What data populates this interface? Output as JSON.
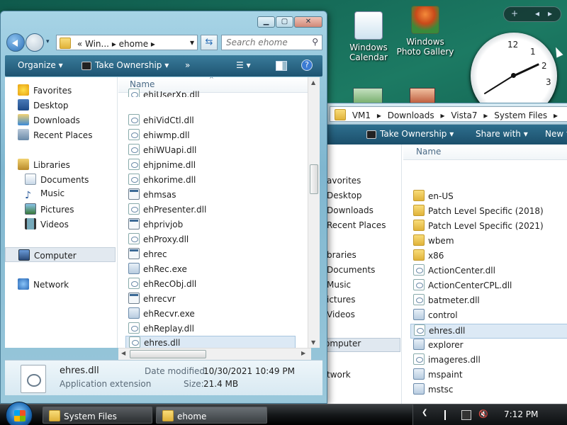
{
  "desktop": {
    "icons": [
      {
        "label_line1": "Windows",
        "label_line2": "Calendar"
      },
      {
        "label_line1": "Windows",
        "label_line2": "Photo Gallery"
      }
    ],
    "gadget_bar": {
      "add": "+",
      "prev": "◂",
      "next": "▸"
    },
    "clock": {
      "numbers": [
        "12",
        "1",
        "2",
        "3"
      ]
    }
  },
  "back_window": {
    "breadcrumbs": [
      "VM1",
      "▸",
      "Downloads",
      "▸",
      "Vista7",
      "▸",
      "System Files",
      "▸"
    ],
    "toolbar": {
      "take_ownership": "Take Ownership",
      "share_with": "Share with",
      "new_folder": "New f"
    },
    "nav_items": [
      "avorites",
      "Desktop",
      "Downloads",
      "Recent Places",
      "braries",
      "Documents",
      "Music",
      "ictures",
      "Videos",
      "omputer",
      "twork"
    ],
    "column_header": "Name",
    "files": [
      {
        "name": "en-US",
        "icon": "folder-icon"
      },
      {
        "name": "Patch Level Specific (2018)",
        "icon": "folder-icon"
      },
      {
        "name": "Patch Level Specific (2021)",
        "icon": "folder-icon"
      },
      {
        "name": "wbem",
        "icon": "folder-icon"
      },
      {
        "name": "x86",
        "icon": "folder-icon"
      },
      {
        "name": "ActionCenter.dll",
        "icon": "dll-icon"
      },
      {
        "name": "ActionCenterCPL.dll",
        "icon": "dll-icon"
      },
      {
        "name": "batmeter.dll",
        "icon": "dll-icon"
      },
      {
        "name": "control",
        "icon": "exe-icon"
      },
      {
        "name": "ehres.dll",
        "icon": "dll-icon"
      },
      {
        "name": "explorer",
        "icon": "exe-icon"
      },
      {
        "name": "imageres.dll",
        "icon": "dll-icon"
      },
      {
        "name": "mspaint",
        "icon": "exe-icon"
      },
      {
        "name": "mstsc",
        "icon": "exe-icon"
      }
    ],
    "selected_file": "ehres.dll"
  },
  "front_window": {
    "address": {
      "prefix": "«",
      "part1": "Win...",
      "sep": "▸",
      "part2": "ehome",
      "sep2": "▸"
    },
    "search_placeholder": "Search ehome",
    "toolbar": {
      "organize": "Organize",
      "take_ownership": "Take Ownership",
      "more": "»"
    },
    "nav_items": [
      {
        "label": "Favorites",
        "icon": "star-icon"
      },
      {
        "label": "Desktop",
        "icon": "desktop-icon"
      },
      {
        "label": "Downloads",
        "icon": "downloads-icon"
      },
      {
        "label": "Recent Places",
        "icon": "recent-places-icon"
      },
      {
        "label": "Libraries",
        "icon": "libraries-icon"
      },
      {
        "label": "Documents",
        "icon": "documents-icon"
      },
      {
        "label": "Music",
        "icon": "music-icon"
      },
      {
        "label": "Pictures",
        "icon": "pictures-icon"
      },
      {
        "label": "Videos",
        "icon": "videos-icon"
      },
      {
        "label": "Computer",
        "icon": "computer-icon"
      },
      {
        "label": "Network",
        "icon": "network-icon"
      }
    ],
    "column_header": "Name",
    "files": [
      {
        "name": "ehiUserXp.dll",
        "icon": "dll-icon"
      },
      {
        "name": "ehiVidCtl.dll",
        "icon": "dll-icon"
      },
      {
        "name": "ehiwmp.dll",
        "icon": "dll-icon"
      },
      {
        "name": "ehiWUapi.dll",
        "icon": "dll-icon"
      },
      {
        "name": "ehjpnime.dll",
        "icon": "dll-icon"
      },
      {
        "name": "ehkorime.dll",
        "icon": "dll-icon"
      },
      {
        "name": "ehmsas",
        "icon": "app-icon"
      },
      {
        "name": "ehPresenter.dll",
        "icon": "dll-icon"
      },
      {
        "name": "ehprivjob",
        "icon": "app-icon"
      },
      {
        "name": "ehProxy.dll",
        "icon": "dll-icon"
      },
      {
        "name": "ehrec",
        "icon": "app-icon"
      },
      {
        "name": "ehRec.exe",
        "icon": "exe-icon"
      },
      {
        "name": "ehRecObj.dll",
        "icon": "dll-icon"
      },
      {
        "name": "ehrecvr",
        "icon": "app-icon"
      },
      {
        "name": "ehRecvr.exe",
        "icon": "exe-icon"
      },
      {
        "name": "ehReplay.dll",
        "icon": "dll-icon"
      },
      {
        "name": "ehres.dll",
        "icon": "dll-icon"
      }
    ],
    "selected_file": "ehres.dll",
    "details": {
      "name": "ehres.dll",
      "type": "Application extension",
      "modified_label": "Date modified:",
      "modified_value": "10/30/2021 10:49 PM",
      "size_label": "Size:",
      "size_value": "21.4 MB"
    }
  },
  "taskbar": {
    "buttons": [
      "System Files",
      "ehome"
    ],
    "time": "7:12 PM"
  }
}
